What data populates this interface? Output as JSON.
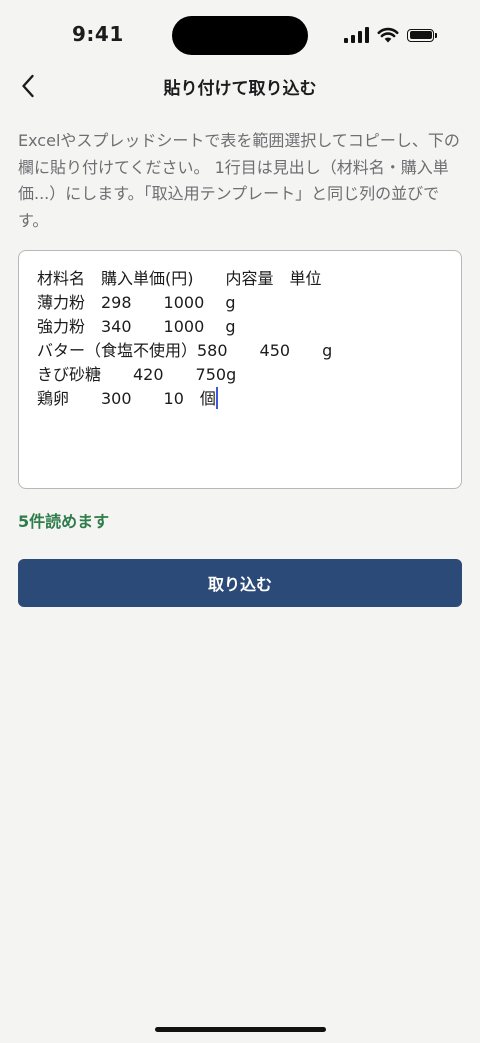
{
  "status_bar": {
    "time": "9:41"
  },
  "nav": {
    "title": "貼り付けて取り込む",
    "back_icon": "chevron-left-icon"
  },
  "instructions": "Excelやスプレッドシートで表を範囲選択してコピーし、下の欄に貼り付けてください。 1行目は見出し（材料名・購入単価...）にします。「取込用テンプレート」と同じ列の並びです。",
  "paste_area": {
    "value": "材料名　購入単価(円)　　内容量　単位\n薄力粉　298　　1000　 g\n強力粉　340　　1000　 g\nバター（食塩不使用）580　　450　　g\nきび砂糖　　420　　750g\n鶏卵　　300　　10　個"
  },
  "parse_status": "5件読めます",
  "import_button": {
    "label": "取り込む"
  },
  "colors": {
    "accent": "#2c4a77",
    "success": "#2e7d4a",
    "background": "#f4f4f2"
  }
}
